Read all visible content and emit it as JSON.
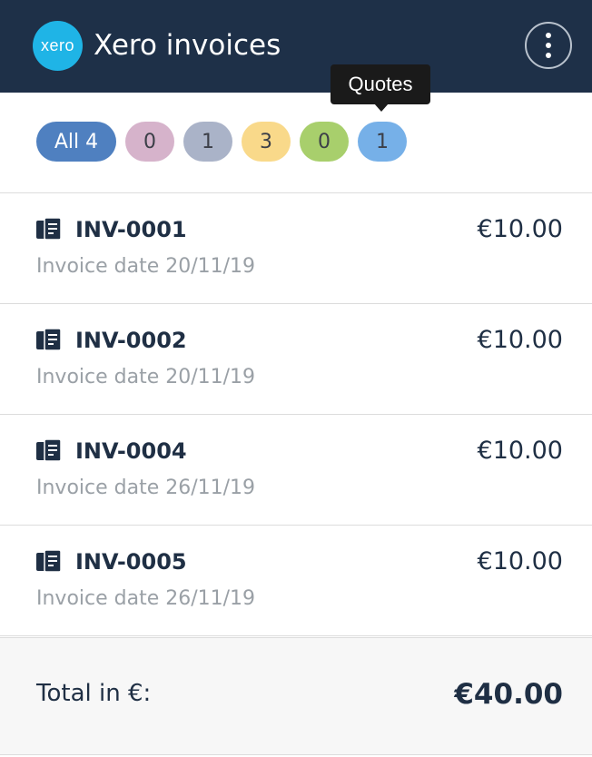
{
  "header": {
    "logo_text": "xero",
    "title": "Xero invoices",
    "menu_icon": "more-vertical-icon",
    "background": "#1e3048"
  },
  "tooltip": {
    "text": "Quotes"
  },
  "filters": [
    {
      "label": "All 4",
      "color": "#4f80c0"
    },
    {
      "label": "0",
      "color": "#d6b3cb"
    },
    {
      "label": "1",
      "color": "#aab3c8"
    },
    {
      "label": "3",
      "color": "#f9d98a"
    },
    {
      "label": "0",
      "color": "#a8cf6c"
    },
    {
      "label": "1",
      "color": "#76b0e8"
    }
  ],
  "invoices": [
    {
      "number": "INV-0001",
      "date": "Invoice date 20/11/19",
      "amount": "€10.00",
      "icon": "invoice-icon"
    },
    {
      "number": "INV-0002",
      "date": "Invoice date 20/11/19",
      "amount": "€10.00",
      "icon": "invoice-icon"
    },
    {
      "number": "INV-0004",
      "date": "Invoice date 26/11/19",
      "amount": "€10.00",
      "icon": "invoice-icon"
    },
    {
      "number": "INV-0005",
      "date": "Invoice date 26/11/19",
      "amount": "€10.00",
      "icon": "invoice-icon"
    }
  ],
  "total": {
    "label": "Total in €:",
    "value": "€40.00"
  }
}
